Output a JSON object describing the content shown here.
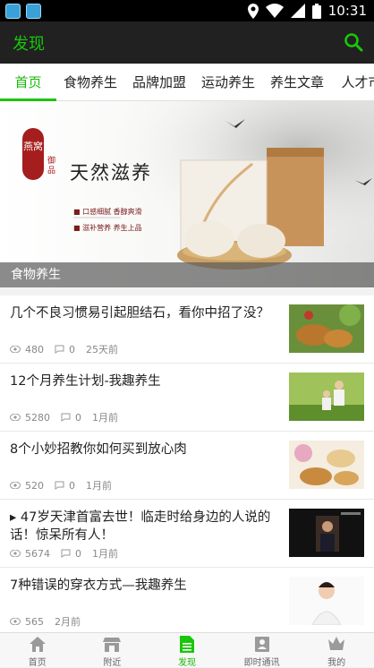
{
  "status_bar": {
    "time": "10:31"
  },
  "app_bar": {
    "title": "发现"
  },
  "tabs": [
    "首页",
    "食物养生",
    "品牌加盟",
    "运动养生",
    "养生文章",
    "人才市"
  ],
  "banner": {
    "caption": "食物养生",
    "headline": "天然滋养",
    "seal_text": "燕窝",
    "side_text": "御品",
    "bullet_1": "■ 口感细腻  香醇爽滑",
    "bullet_2": "■ 滋补营养  养生上品"
  },
  "articles": [
    {
      "title": "几个不良习惯易引起胆结石，看你中招了没？",
      "views": "480",
      "comments": "0",
      "time": "25天前",
      "thumb": "mooncakes"
    },
    {
      "title": "12个月养生计划-我趣养生",
      "views": "5280",
      "comments": "0",
      "time": "1月前",
      "thumb": "couple-outdoors"
    },
    {
      "title": "8个小妙招教你如何买到放心肉",
      "views": "520",
      "comments": "0",
      "time": "1月前",
      "thumb": "tea-cakes"
    },
    {
      "title": "▸ 47岁天津首富去世！临走时给身边的人说的话！惊呆所有人！",
      "views": "5674",
      "comments": "0",
      "time": "1月前",
      "thumb": "businessman"
    },
    {
      "title": "7种错误的穿衣方式—我趣养生",
      "views": "565",
      "comments": "",
      "time": "2月前",
      "thumb": "woman"
    }
  ],
  "bottom_nav": [
    {
      "label": "首页",
      "icon": "home-icon"
    },
    {
      "label": "附近",
      "icon": "shop-icon"
    },
    {
      "label": "发现",
      "icon": "document-icon",
      "active": true
    },
    {
      "label": "即时通讯",
      "icon": "contacts-icon"
    },
    {
      "label": "我的",
      "icon": "crown-icon"
    }
  ],
  "colors": {
    "accent": "#19c60a",
    "appbar": "#212121"
  }
}
